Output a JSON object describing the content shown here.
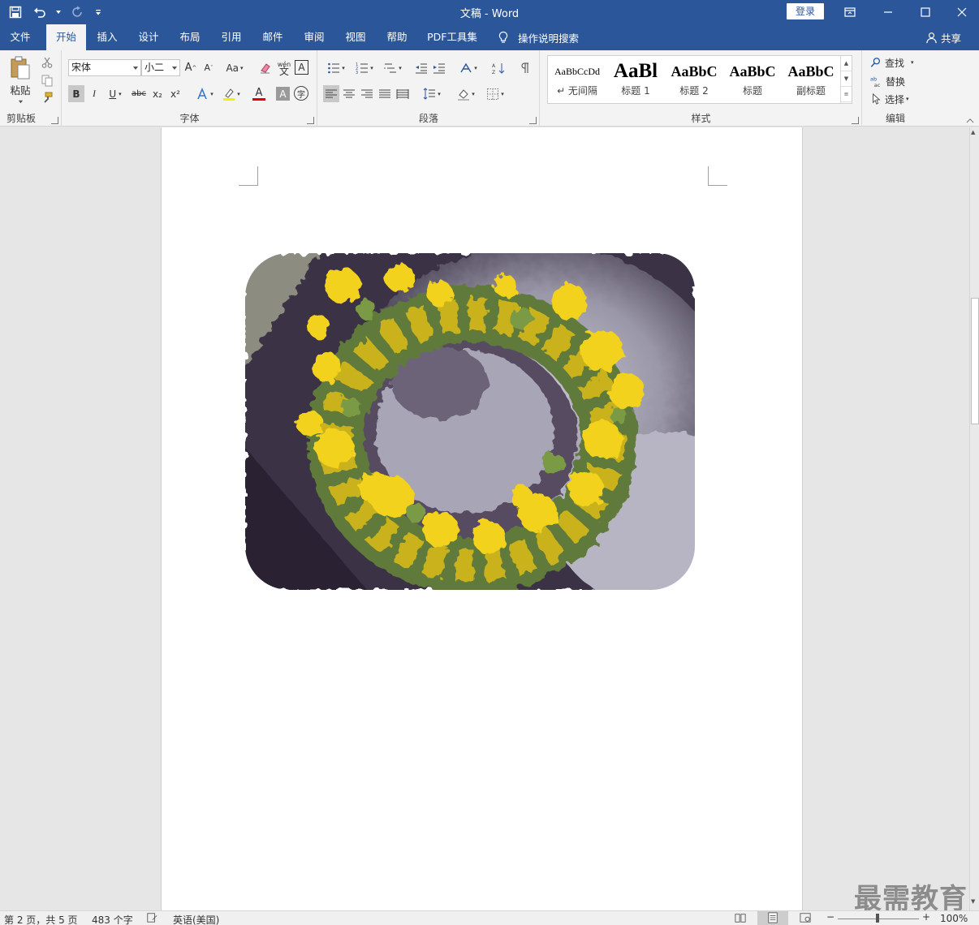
{
  "window": {
    "title": "文稿 - Word",
    "login_label": "登录"
  },
  "tabs": [
    {
      "label": "文件"
    },
    {
      "label": "开始",
      "active": true
    },
    {
      "label": "插入"
    },
    {
      "label": "设计"
    },
    {
      "label": "布局"
    },
    {
      "label": "引用"
    },
    {
      "label": "邮件"
    },
    {
      "label": "审阅"
    },
    {
      "label": "视图"
    },
    {
      "label": "帮助"
    },
    {
      "label": "PDF工具集"
    }
  ],
  "tell_me": "操作说明搜索",
  "share": "共享",
  "ribbon": {
    "clipboard": {
      "label": "剪贴板",
      "paste": "粘贴"
    },
    "font": {
      "label": "字体",
      "font_name": "宋体",
      "font_size": "小二",
      "case_btn": "Aa",
      "wen": "wén",
      "bold": "B",
      "italic": "I",
      "underline": "U",
      "strike": "abc",
      "sub": "x₂",
      "sup": "x²",
      "color_a": "A",
      "char_shade": "A",
      "enclose": "字"
    },
    "paragraph": {
      "label": "段落"
    },
    "styles": {
      "label": "样式",
      "items": [
        {
          "sample": "AaBbCcDd",
          "name": "↵ 无间隔"
        },
        {
          "sample": "AaBl",
          "name": "标题 1"
        },
        {
          "sample": "AaBbC",
          "name": "标题 2"
        },
        {
          "sample": "AaBbC",
          "name": "标题"
        },
        {
          "sample": "AaBbC",
          "name": "副标题"
        }
      ]
    },
    "editing": {
      "label": "编辑",
      "find": "查找",
      "replace": "替换",
      "select": "选择"
    }
  },
  "status": {
    "page": "第 2 页，共 5 页",
    "words": "483 个字",
    "language": "英语(美国)",
    "zoom": "100%"
  },
  "watermark": "最需教育",
  "colors": {
    "brand": "#2b579a",
    "ribbon_bg": "#f3f3f3",
    "flower_yellow": "#f2d21a"
  }
}
